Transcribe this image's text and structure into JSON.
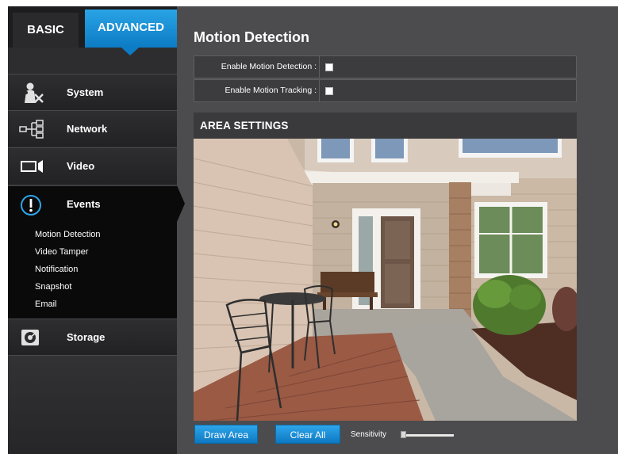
{
  "tabs": {
    "basic": "BASIC",
    "advanced": "ADVANCED"
  },
  "menu": [
    {
      "label": "System",
      "icon": "system-icon"
    },
    {
      "label": "Network",
      "icon": "network-icon"
    },
    {
      "label": "Video",
      "icon": "video-camera-icon"
    },
    {
      "label": "Events",
      "icon": "exclamation-circle-icon"
    },
    {
      "label": "Storage",
      "icon": "storage-icon"
    }
  ],
  "events_submenu": [
    "Motion Detection",
    "Video Tamper",
    "Notification",
    "Snapshot",
    "Email"
  ],
  "active_menu": "Events",
  "page_title": "Motion Detection",
  "options": {
    "enable_motion_detection": {
      "label": "Enable Motion Detection :",
      "checked": false
    },
    "enable_motion_tracking": {
      "label": "Enable Motion Tracking :",
      "checked": false
    }
  },
  "area_settings": {
    "title": "AREA SETTINGS"
  },
  "buttons": {
    "draw_area": "Draw Area",
    "clear_all": "Clear All"
  },
  "sensitivity": {
    "label": "Sensitivity",
    "level": 0
  },
  "colors": {
    "accent_blue": "#0c7cc5",
    "panel_dark": "#2b2b2d",
    "background": "#4c4c4e"
  }
}
